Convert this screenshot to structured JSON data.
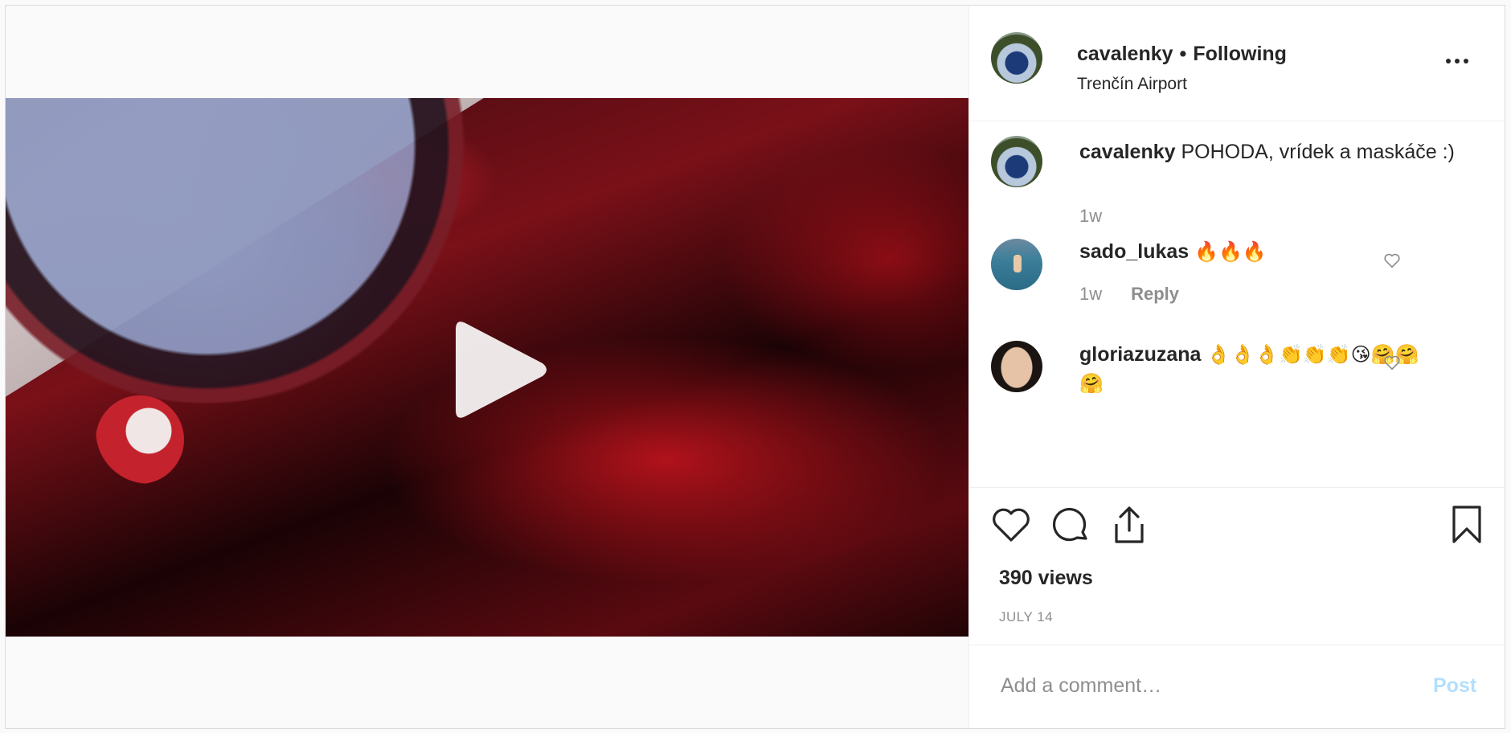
{
  "post": {
    "header": {
      "username": "cavalenky",
      "separator": "•",
      "follow_status": "Following",
      "location": "Trenčín Airport",
      "more_icon": "more-options-icon"
    },
    "caption": {
      "username": "cavalenky",
      "text": "POHODA, vrídek a maskáče :)",
      "time": "1w"
    },
    "comments": [
      {
        "username": "sado_lukas",
        "text": "🔥🔥🔥",
        "time": "1w",
        "reply_label": "Reply"
      },
      {
        "username": "gloriazuzana",
        "text": "👌👌👌👏👏👏😘🤗🤗🤗"
      }
    ],
    "views": "390 views",
    "date": "JULY 14",
    "add_comment": {
      "placeholder": "Add a comment…",
      "post_label": "Post"
    }
  },
  "colors": {
    "link_blue_disabled": "#b2dffc",
    "muted": "#8e8e8e",
    "text": "#262626"
  }
}
